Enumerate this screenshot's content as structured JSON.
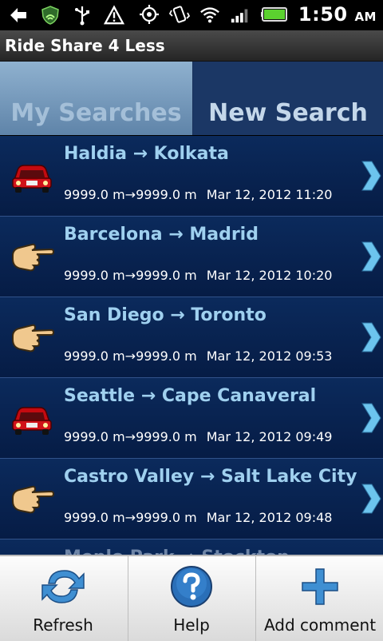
{
  "status": {
    "time": "1:50",
    "ampm": "AM"
  },
  "app": {
    "title": "Ride Share 4 Less"
  },
  "tabs": {
    "my_searches": "My Searches",
    "new_search": "New Search"
  },
  "rows": [
    {
      "route": "Haldia → Kolkata",
      "distance": "9999.0 m→9999.0 m",
      "date": "Mar 12, 2012 11:20",
      "icon": "car-icon"
    },
    {
      "route": "Barcelona → Madrid",
      "distance": "9999.0 m→9999.0 m",
      "date": "Mar 12, 2012 10:20",
      "icon": "thumb-icon"
    },
    {
      "route": "San Diego → Toronto",
      "distance": "9999.0 m→9999.0 m",
      "date": "Mar 12, 2012 09:53",
      "icon": "thumb-icon"
    },
    {
      "route": "Seattle → Cape Canaveral",
      "distance": "9999.0 m→9999.0 m",
      "date": "Mar 12, 2012 09:49",
      "icon": "car-icon"
    },
    {
      "route": "Castro Valley → Salt Lake City",
      "distance": "9999.0 m→9999.0 m",
      "date": "Mar 12, 2012 09:48",
      "icon": "thumb-icon"
    }
  ],
  "partial_row": "Menlo Park → Stockton",
  "bottom": {
    "refresh": "Refresh",
    "help": "Help",
    "add_comment": "Add comment"
  },
  "colors": {
    "list_bg": "#0b2456",
    "route_text": "#9fd0ef",
    "chevron": "#6cc4ee"
  }
}
